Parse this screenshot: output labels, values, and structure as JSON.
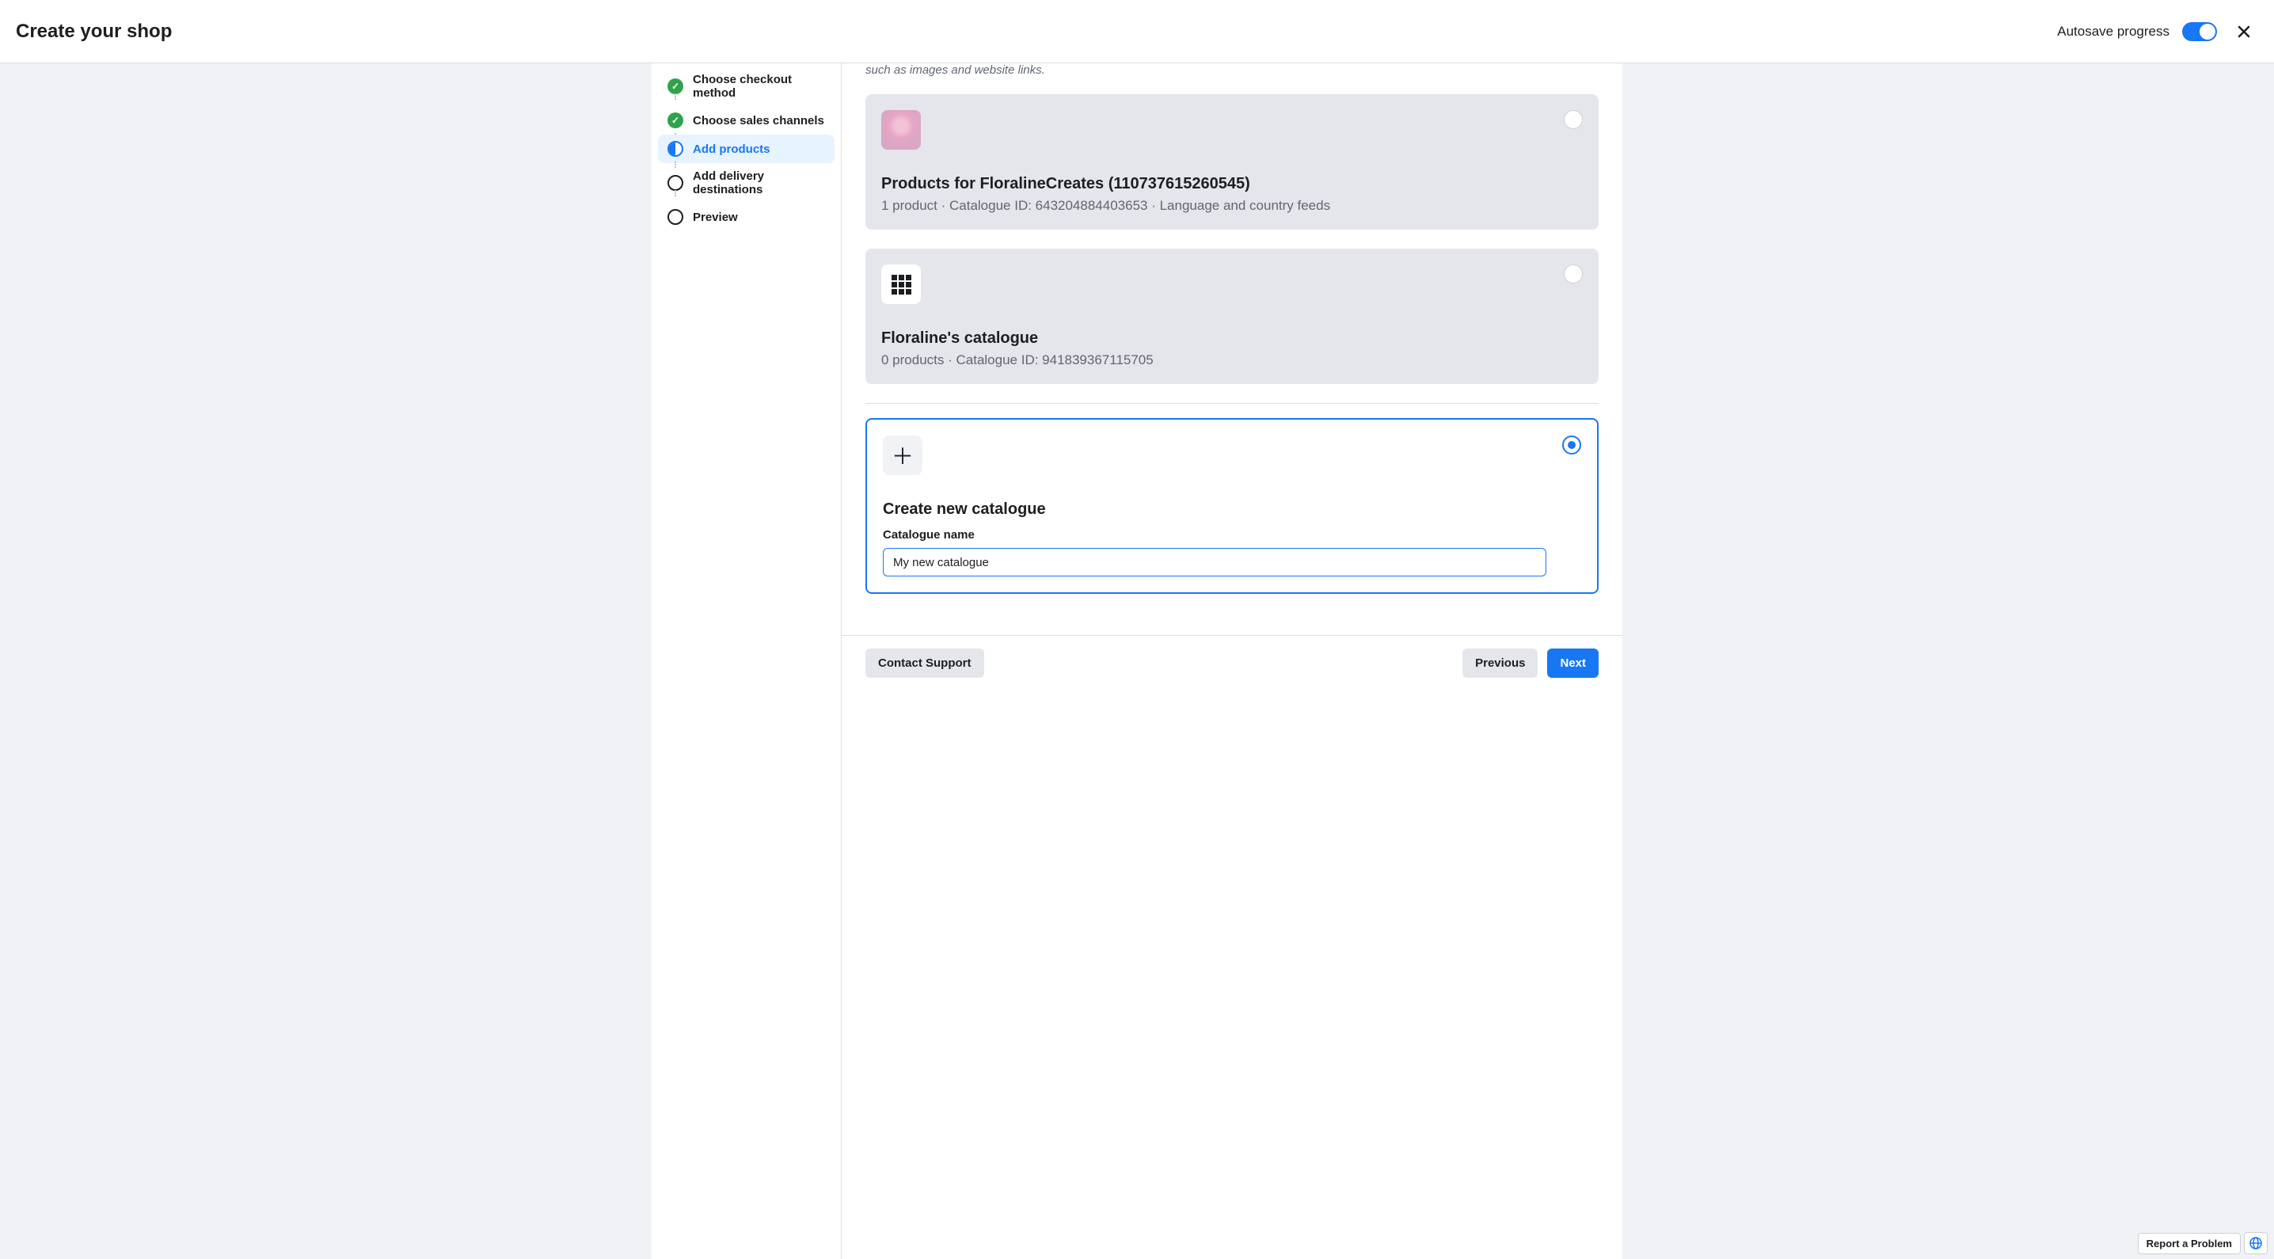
{
  "header": {
    "title": "Create your shop",
    "autosave_label": "Autosave progress",
    "autosave_on": true
  },
  "sidebar": {
    "steps": [
      {
        "label": "Choose checkout method",
        "state": "completed"
      },
      {
        "label": "Choose sales channels",
        "state": "completed"
      },
      {
        "label": "Add products",
        "state": "current"
      },
      {
        "label": "Add delivery destinations",
        "state": "pending"
      },
      {
        "label": "Preview",
        "state": "pending"
      }
    ]
  },
  "content": {
    "truncated_hint": "such as images and website links.",
    "catalogues": [
      {
        "title": "Products for FloralineCreates (110737615260545)",
        "meta": "1 product · Catalogue ID: 643204884403653 · Language and country feeds",
        "thumb_type": "flowers",
        "selected": false
      },
      {
        "title": "Floraline's catalogue",
        "meta": "0 products · Catalogue ID: 941839367115705",
        "thumb_type": "grid",
        "selected": false
      }
    ],
    "new_catalogue": {
      "title": "Create new catalogue",
      "input_label": "Catalogue name",
      "input_value": "My new catalogue",
      "selected": true
    }
  },
  "footer": {
    "contact_support": "Contact Support",
    "previous": "Previous",
    "next": "Next"
  },
  "bottom": {
    "report_problem": "Report a Problem"
  }
}
